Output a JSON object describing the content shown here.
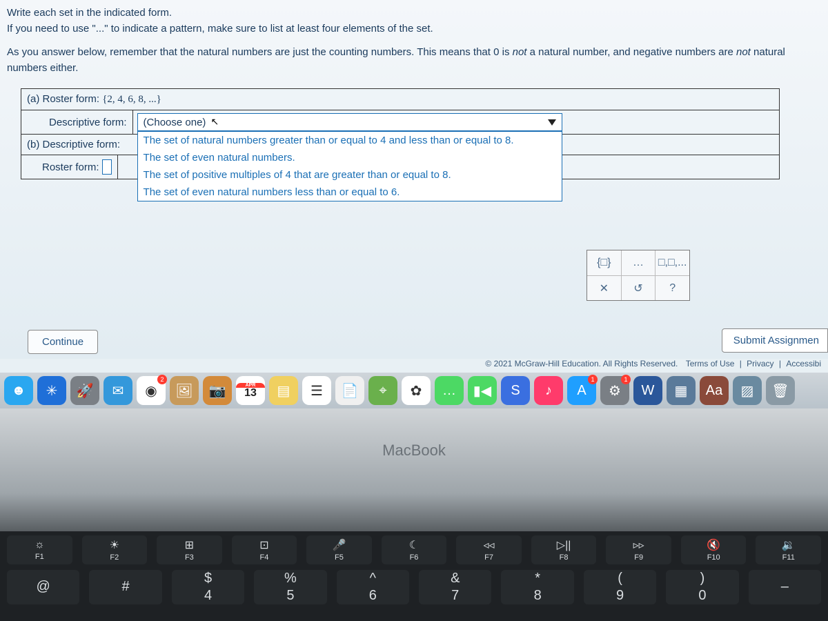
{
  "instructions": {
    "line1": "Write each set in the indicated form.",
    "line2": "If you need to use \"...\" to indicate a pattern, make sure to list at least four elements of the set."
  },
  "note_prefix": "As you answer below, remember that the natural numbers are just the counting numbers. This means that ",
  "note_zero": "0",
  "note_mid1": " is ",
  "note_not1": "not",
  "note_mid2": " a natural number, and negative numbers are ",
  "note_not2": "not",
  "note_end": " natural numbers either.",
  "a": {
    "label": "(a)  Roster form:",
    "value": "{2, 4, 6, 8, ...}",
    "descriptive_label": "Descriptive form:",
    "dropdown_placeholder": "(Choose one)",
    "options": [
      "The set of natural numbers greater than or equal to 4 and less than or equal to 8.",
      "The set of even natural numbers.",
      "The set of positive multiples of 4 that are greater than or equal to 8.",
      "The set of even natural numbers less than or equal to 6."
    ]
  },
  "b": {
    "label": "(b)  Descriptive form:",
    "roster_label": "Roster form:"
  },
  "palette": {
    "r1": [
      "{□}",
      "…",
      "□,□,..."
    ],
    "r2": [
      "✕",
      "↺",
      "?"
    ]
  },
  "buttons": {
    "continue": "Continue",
    "submit": "Submit Assignmen"
  },
  "footer": {
    "copyright": "© 2021 McGraw-Hill Education. All Rights Reserved.",
    "terms": "Terms of Use",
    "privacy": "Privacy",
    "access": "Accessibi"
  },
  "dock": [
    {
      "name": "finder",
      "bg": "#2aa7f0",
      "glyph": "☻"
    },
    {
      "name": "safari",
      "bg": "#1f6fd8",
      "glyph": "✳"
    },
    {
      "name": "launchpad",
      "bg": "#7a7f85",
      "glyph": "🚀"
    },
    {
      "name": "mail",
      "bg": "#3498db",
      "glyph": "✉"
    },
    {
      "name": "chrome",
      "bg": "#ffffff",
      "glyph": "◉",
      "badge": "2"
    },
    {
      "name": "preview",
      "bg": "#c79a5b",
      "glyph": "🖼"
    },
    {
      "name": "photobooth",
      "bg": "#d38a3a",
      "glyph": "📷"
    },
    {
      "name": "calendar",
      "bg": "#ffffff",
      "glyph": "13",
      "text": true,
      "top": "APR"
    },
    {
      "name": "notes",
      "bg": "#f0d060",
      "glyph": "▤"
    },
    {
      "name": "reminders",
      "bg": "#ffffff",
      "glyph": "☰"
    },
    {
      "name": "pages",
      "bg": "#f0f0f0",
      "glyph": "📄"
    },
    {
      "name": "maps",
      "bg": "#6ab04c",
      "glyph": "⌖"
    },
    {
      "name": "photos",
      "bg": "#ffffff",
      "glyph": "✿"
    },
    {
      "name": "messages",
      "bg": "#4cd964",
      "glyph": "…"
    },
    {
      "name": "facetime",
      "bg": "#4cd964",
      "glyph": "▮◀"
    },
    {
      "name": "shortcuts",
      "bg": "#3a6fe0",
      "glyph": "S"
    },
    {
      "name": "music",
      "bg": "#ff3b6b",
      "glyph": "♪"
    },
    {
      "name": "appstore",
      "bg": "#1f9fff",
      "glyph": "A",
      "badge": "1"
    },
    {
      "name": "settings",
      "bg": "#7a7f85",
      "glyph": "⚙",
      "badge": "1"
    },
    {
      "name": "word",
      "bg": "#2b579a",
      "glyph": "W"
    },
    {
      "name": "wallpaper",
      "bg": "#5a7a9a",
      "glyph": "▦"
    },
    {
      "name": "dictionary",
      "bg": "#8a4a3a",
      "glyph": "Aa"
    },
    {
      "name": "landscape",
      "bg": "#6a8aa0",
      "glyph": "▨"
    },
    {
      "name": "trash",
      "bg": "#8a9aa5",
      "glyph": "🗑"
    }
  ],
  "laptop_label": "MacBook",
  "fn_keys": [
    {
      "sym": "☼",
      "label": "F1"
    },
    {
      "sym": "☀",
      "label": "F2"
    },
    {
      "sym": "⊞",
      "label": "F3"
    },
    {
      "sym": "⊡",
      "label": "F4"
    },
    {
      "sym": "🎤",
      "label": "F5"
    },
    {
      "sym": "☾",
      "label": "F6"
    },
    {
      "sym": "◃◃",
      "label": "F7"
    },
    {
      "sym": "▷||",
      "label": "F8"
    },
    {
      "sym": "▹▹",
      "label": "F9"
    },
    {
      "sym": "🔇",
      "label": "F10"
    },
    {
      "sym": "🔉",
      "label": "F11"
    }
  ],
  "num_keys": [
    {
      "top": "@",
      "bot": ""
    },
    {
      "top": "#",
      "bot": ""
    },
    {
      "top": "$",
      "bot": "4"
    },
    {
      "top": "%",
      "bot": "5"
    },
    {
      "top": "^",
      "bot": "6"
    },
    {
      "top": "&",
      "bot": "7"
    },
    {
      "top": "*",
      "bot": "8"
    },
    {
      "top": "(",
      "bot": "9"
    },
    {
      "top": ")",
      "bot": "0"
    },
    {
      "top": "–",
      "bot": ""
    }
  ]
}
